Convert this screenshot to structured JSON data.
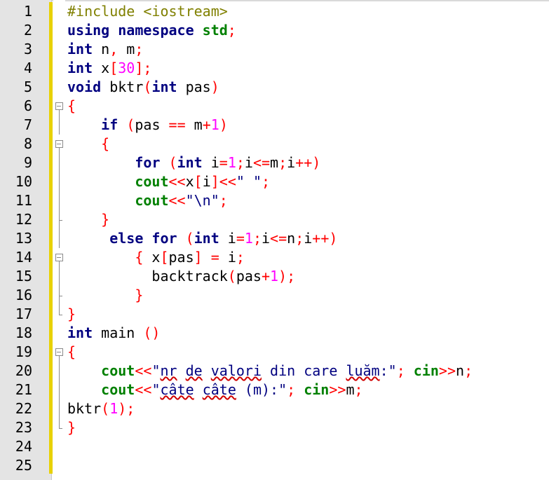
{
  "editor": {
    "lines": [
      {
        "n": "1",
        "segs": [
          {
            "t": "#include <iostream>",
            "c": "inc"
          }
        ]
      },
      {
        "n": "2",
        "segs": [
          {
            "t": "using namespace ",
            "c": "kw"
          },
          {
            "t": "std",
            "c": "typ"
          },
          {
            "t": ";",
            "c": "op"
          }
        ]
      },
      {
        "n": "3",
        "segs": [
          {
            "t": "int",
            "c": "kw"
          },
          {
            "t": " n"
          },
          {
            "t": ",",
            "c": "op"
          },
          {
            "t": " m"
          },
          {
            "t": ";",
            "c": "op"
          }
        ]
      },
      {
        "n": "4",
        "segs": [
          {
            "t": "int",
            "c": "kw"
          },
          {
            "t": " x"
          },
          {
            "t": "[",
            "c": "op"
          },
          {
            "t": "30",
            "c": "num"
          },
          {
            "t": "];",
            "c": "op"
          }
        ]
      },
      {
        "n": "5",
        "segs": [
          {
            "t": "void",
            "c": "kw"
          },
          {
            "t": " bktr"
          },
          {
            "t": "(",
            "c": "op"
          },
          {
            "t": "int",
            "c": "kw"
          },
          {
            "t": " pas"
          },
          {
            "t": ")",
            "c": "op"
          }
        ]
      },
      {
        "n": "6",
        "segs": [
          {
            "t": "{",
            "c": "op"
          }
        ]
      },
      {
        "n": "7",
        "segs": [
          {
            "t": "    "
          },
          {
            "t": "if",
            "c": "kw"
          },
          {
            "t": " "
          },
          {
            "t": "(",
            "c": "op"
          },
          {
            "t": "pas "
          },
          {
            "t": "==",
            "c": "op"
          },
          {
            "t": " m"
          },
          {
            "t": "+",
            "c": "op"
          },
          {
            "t": "1",
            "c": "num"
          },
          {
            "t": ")",
            "c": "op"
          }
        ]
      },
      {
        "n": "8",
        "segs": [
          {
            "t": "    "
          },
          {
            "t": "{",
            "c": "op"
          }
        ]
      },
      {
        "n": "9",
        "segs": [
          {
            "t": "        "
          },
          {
            "t": "for",
            "c": "kw"
          },
          {
            "t": " "
          },
          {
            "t": "(",
            "c": "op"
          },
          {
            "t": "int",
            "c": "kw"
          },
          {
            "t": " i"
          },
          {
            "t": "=",
            "c": "op"
          },
          {
            "t": "1",
            "c": "num"
          },
          {
            "t": ";",
            "c": "op"
          },
          {
            "t": "i"
          },
          {
            "t": "<=",
            "c": "op"
          },
          {
            "t": "m"
          },
          {
            "t": ";",
            "c": "op"
          },
          {
            "t": "i"
          },
          {
            "t": "++)",
            "c": "op"
          }
        ]
      },
      {
        "n": "10",
        "segs": [
          {
            "t": "        "
          },
          {
            "t": "cout",
            "c": "typ"
          },
          {
            "t": "<<",
            "c": "op"
          },
          {
            "t": "x"
          },
          {
            "t": "[",
            "c": "op"
          },
          {
            "t": "i"
          },
          {
            "t": "]<<",
            "c": "op"
          },
          {
            "t": "\" \"",
            "c": "strt"
          },
          {
            "t": ";",
            "c": "op"
          }
        ]
      },
      {
        "n": "11",
        "segs": [
          {
            "t": "        "
          },
          {
            "t": "cout",
            "c": "typ"
          },
          {
            "t": "<<",
            "c": "op"
          },
          {
            "t": "\"\\n\"",
            "c": "strt"
          },
          {
            "t": ";",
            "c": "op"
          }
        ]
      },
      {
        "n": "12",
        "segs": [
          {
            "t": "    "
          },
          {
            "t": "}",
            "c": "op"
          }
        ]
      },
      {
        "n": "13",
        "segs": [
          {
            "t": "     "
          },
          {
            "t": "else for",
            "c": "kw"
          },
          {
            "t": " "
          },
          {
            "t": "(",
            "c": "op"
          },
          {
            "t": "int",
            "c": "kw"
          },
          {
            "t": " i"
          },
          {
            "t": "=",
            "c": "op"
          },
          {
            "t": "1",
            "c": "num"
          },
          {
            "t": ";",
            "c": "op"
          },
          {
            "t": "i"
          },
          {
            "t": "<=",
            "c": "op"
          },
          {
            "t": "n"
          },
          {
            "t": ";",
            "c": "op"
          },
          {
            "t": "i"
          },
          {
            "t": "++)",
            "c": "op"
          }
        ]
      },
      {
        "n": "14",
        "segs": [
          {
            "t": "        "
          },
          {
            "t": "{",
            "c": "op"
          },
          {
            "t": " x"
          },
          {
            "t": "[",
            "c": "op"
          },
          {
            "t": "pas"
          },
          {
            "t": "]",
            "c": "op"
          },
          {
            "t": " "
          },
          {
            "t": "=",
            "c": "op"
          },
          {
            "t": " i"
          },
          {
            "t": ";",
            "c": "op"
          }
        ]
      },
      {
        "n": "15",
        "segs": [
          {
            "t": "          backtrack"
          },
          {
            "t": "(",
            "c": "op"
          },
          {
            "t": "pas"
          },
          {
            "t": "+",
            "c": "op"
          },
          {
            "t": "1",
            "c": "num"
          },
          {
            "t": ");",
            "c": "op"
          }
        ]
      },
      {
        "n": "16",
        "segs": [
          {
            "t": "        "
          },
          {
            "t": "}",
            "c": "op"
          }
        ]
      },
      {
        "n": "17",
        "segs": [
          {
            "t": "}",
            "c": "op"
          }
        ]
      },
      {
        "n": "18",
        "segs": [
          {
            "t": "int",
            "c": "kw"
          },
          {
            "t": " main "
          },
          {
            "t": "()",
            "c": "op"
          }
        ]
      },
      {
        "n": "19",
        "segs": [
          {
            "t": "{",
            "c": "op"
          }
        ]
      },
      {
        "n": "20",
        "segs": [
          {
            "t": "    "
          },
          {
            "t": "cout",
            "c": "typ"
          },
          {
            "t": "<<",
            "c": "op"
          },
          {
            "t": "\"",
            "c": "strt"
          },
          {
            "t": "nr",
            "c": "strt sq"
          },
          {
            "t": " ",
            "c": "strt"
          },
          {
            "t": "de",
            "c": "strt sq"
          },
          {
            "t": " ",
            "c": "strt"
          },
          {
            "t": "valori",
            "c": "strt sq"
          },
          {
            "t": " din care ",
            "c": "strt"
          },
          {
            "t": "luăm",
            "c": "strt sq"
          },
          {
            "t": ":\"",
            "c": "strt"
          },
          {
            "t": ";",
            "c": "op"
          },
          {
            "t": " "
          },
          {
            "t": "cin",
            "c": "typ"
          },
          {
            "t": ">>",
            "c": "op"
          },
          {
            "t": "n"
          },
          {
            "t": ";",
            "c": "op"
          }
        ]
      },
      {
        "n": "21",
        "segs": [
          {
            "t": "    "
          },
          {
            "t": "cout",
            "c": "typ"
          },
          {
            "t": "<<",
            "c": "op"
          },
          {
            "t": "\"",
            "c": "strt"
          },
          {
            "t": "câte",
            "c": "strt sq"
          },
          {
            "t": " ",
            "c": "strt"
          },
          {
            "t": "câte",
            "c": "strt sq"
          },
          {
            "t": " (m):\"",
            "c": "strt"
          },
          {
            "t": ";",
            "c": "op"
          },
          {
            "t": " "
          },
          {
            "t": "cin",
            "c": "typ"
          },
          {
            "t": ">>",
            "c": "op"
          },
          {
            "t": "m"
          },
          {
            "t": ";",
            "c": "op"
          }
        ]
      },
      {
        "n": "22",
        "segs": [
          {
            "t": "bktr"
          },
          {
            "t": "(",
            "c": "op"
          },
          {
            "t": "1",
            "c": "num"
          },
          {
            "t": ");",
            "c": "op"
          }
        ]
      },
      {
        "n": "23",
        "segs": [
          {
            "t": "}",
            "c": "op"
          }
        ]
      },
      {
        "n": "24",
        "segs": []
      },
      {
        "n": "25",
        "segs": []
      }
    ],
    "fold": [
      "",
      "",
      "",
      "",
      "",
      "box",
      "vline",
      "box",
      "vline",
      "vline",
      "vline",
      "tee",
      "vline",
      "box",
      "vline",
      "tee",
      "end",
      "",
      "box",
      "vline",
      "vline",
      "vline",
      "end",
      "",
      ""
    ]
  }
}
